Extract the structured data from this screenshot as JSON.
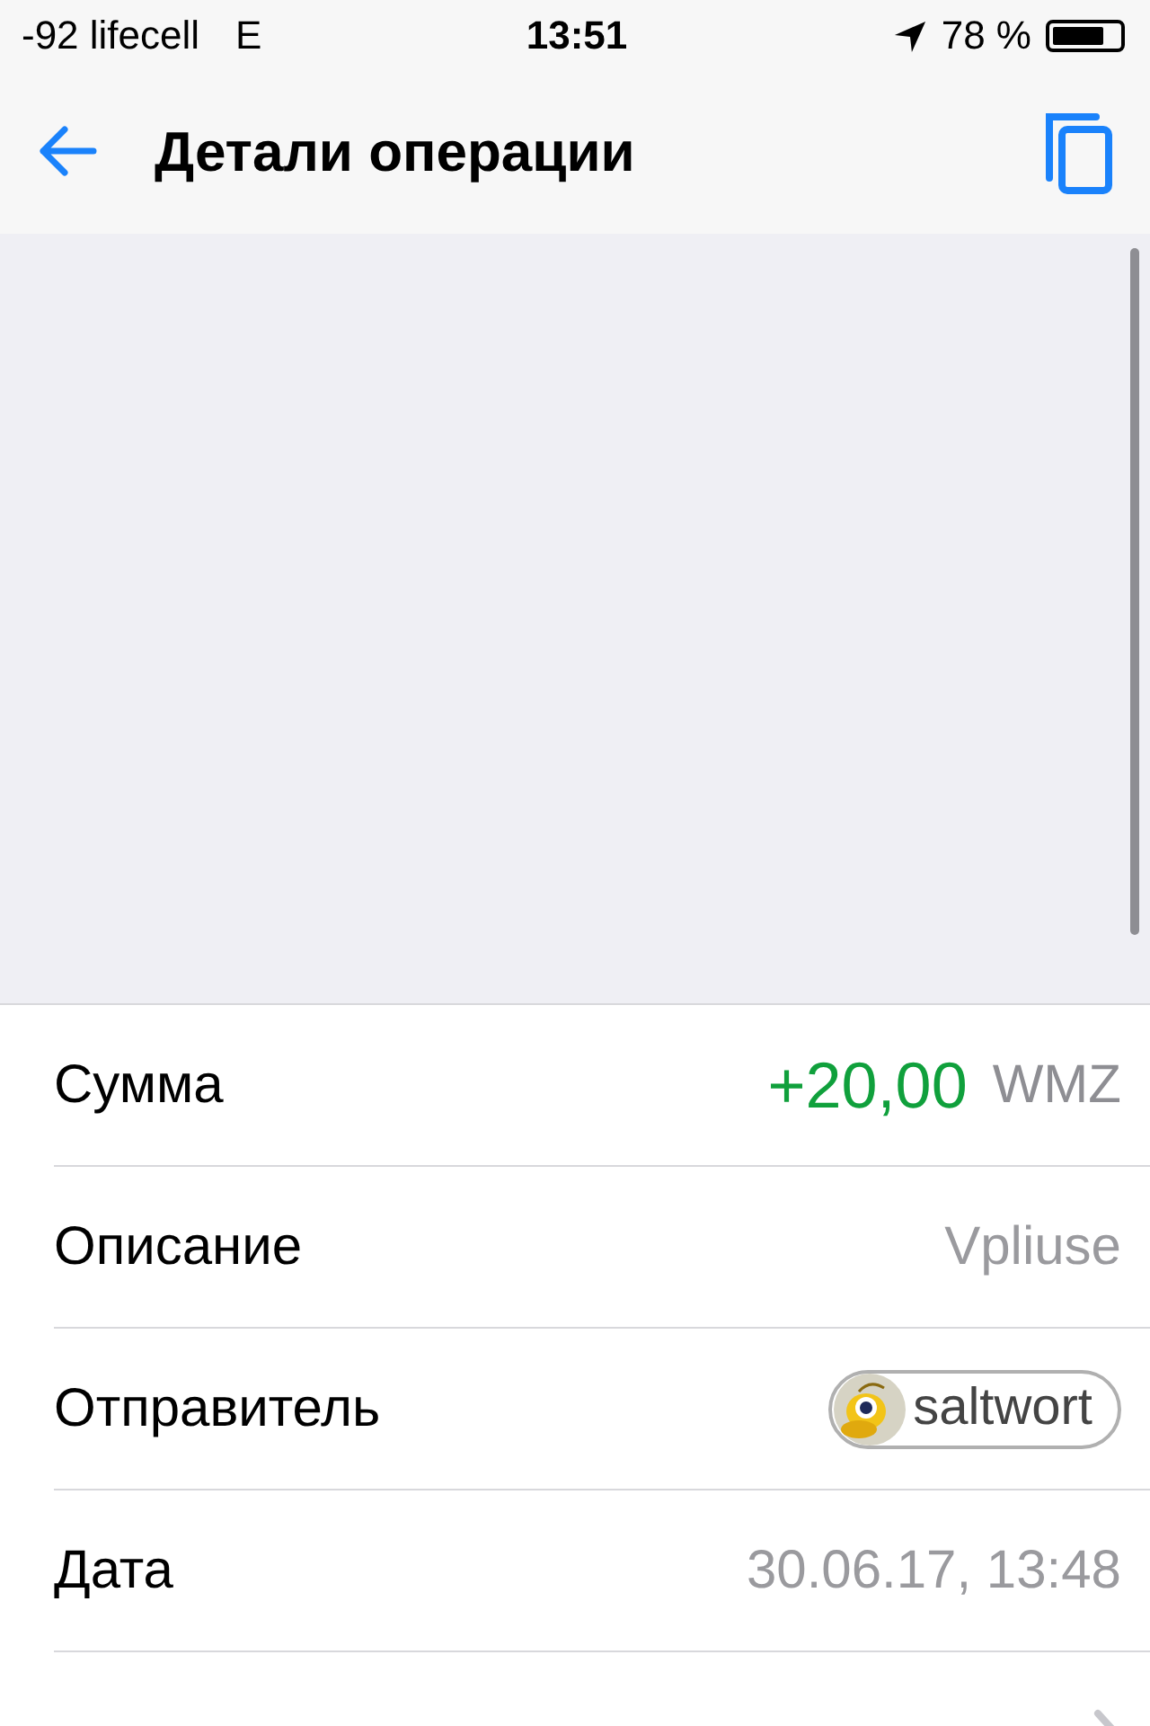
{
  "status_bar": {
    "carrier": "-92 lifecell",
    "network": "E",
    "time": "13:51",
    "battery": "78 %"
  },
  "nav": {
    "title": "Детали операции"
  },
  "rows": [
    {
      "kind": "amount",
      "label": "Сумма",
      "value": "+20,00",
      "unit": "WMZ"
    },
    {
      "kind": "text",
      "label": "Описание",
      "value": "Vpliuse"
    },
    {
      "kind": "contact",
      "label": "Отправитель",
      "value": "saltwort"
    },
    {
      "kind": "text",
      "label": "Дата",
      "value": "30.06.17, 13:48"
    },
    {
      "kind": "link"
    }
  ]
}
